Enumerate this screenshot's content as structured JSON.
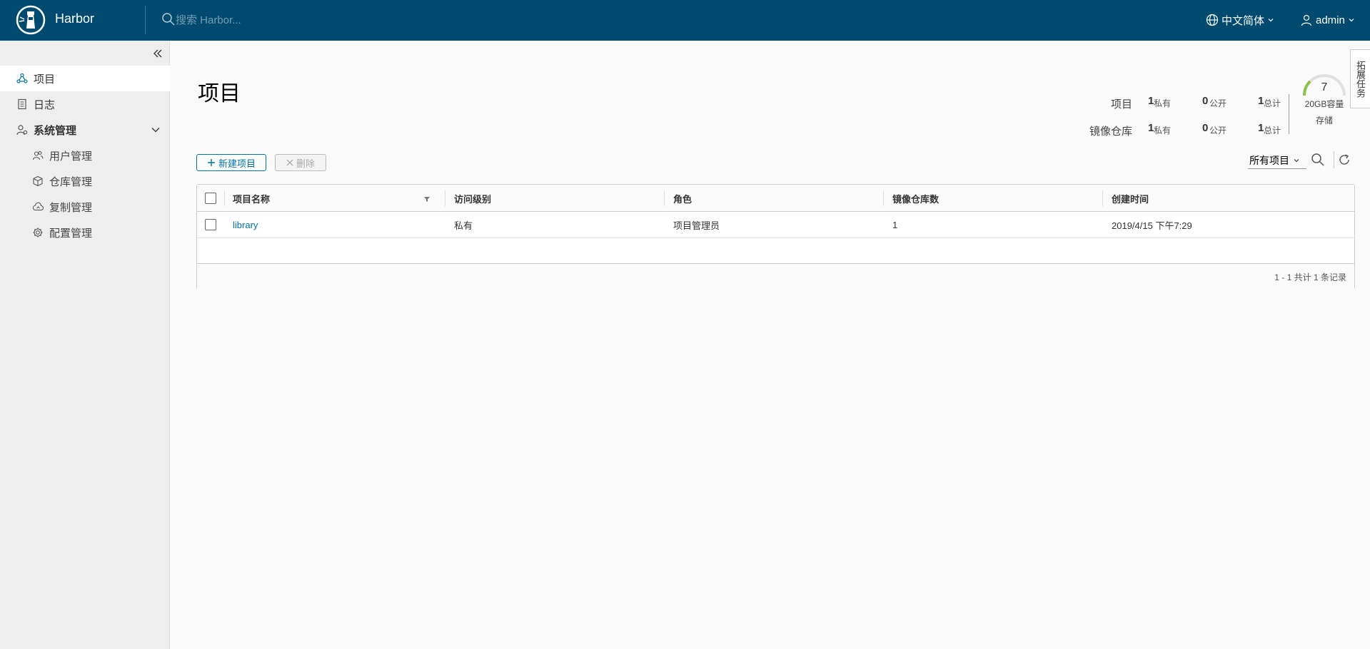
{
  "header": {
    "brand": "Harbor",
    "search_placeholder": "搜索 Harbor...",
    "language": "中文简体",
    "user": "admin",
    "background_color": "#004a70"
  },
  "sidebar": {
    "items": [
      {
        "label": "项目",
        "icon": "projects-icon",
        "active": true
      },
      {
        "label": "日志",
        "icon": "log-icon"
      },
      {
        "label": "系统管理",
        "icon": "system-admin-icon",
        "expanded": true
      },
      {
        "label": "用户管理",
        "icon": "users-icon"
      },
      {
        "label": "仓库管理",
        "icon": "registry-icon"
      },
      {
        "label": "复制管理",
        "icon": "replication-icon"
      },
      {
        "label": "配置管理",
        "icon": "config-icon"
      }
    ]
  },
  "side_tab": "拓展任务",
  "main": {
    "title": "项目",
    "summary": {
      "rows": [
        {
          "label": "项目",
          "private_count": "1",
          "private_label": "私有",
          "public_count": "0",
          "public_label": "公开",
          "total_count": "1",
          "total_label": "总计"
        },
        {
          "label": "镜像仓库",
          "private_count": "1",
          "private_label": "私有",
          "public_count": "0",
          "public_label": "公开",
          "total_count": "1",
          "total_label": "总计"
        }
      ],
      "storage": {
        "value": "7",
        "capacity": "20GB容量",
        "label": "存储"
      }
    },
    "toolbar": {
      "new_project": "新建项目",
      "delete": "删除",
      "filter_selected": "所有项目"
    },
    "table": {
      "columns": [
        "项目名称",
        "访问级别",
        "角色",
        "镜像仓库数",
        "创建时间"
      ],
      "rows": [
        {
          "name": "library",
          "access": "私有",
          "role": "项目管理员",
          "repo_count": "1",
          "created": "2019/4/15 下午7:29"
        }
      ],
      "footer": "1 - 1 共计 1 条记录"
    }
  },
  "colors": {
    "accent": "#0072a3",
    "gauge": "#8bc34a"
  }
}
